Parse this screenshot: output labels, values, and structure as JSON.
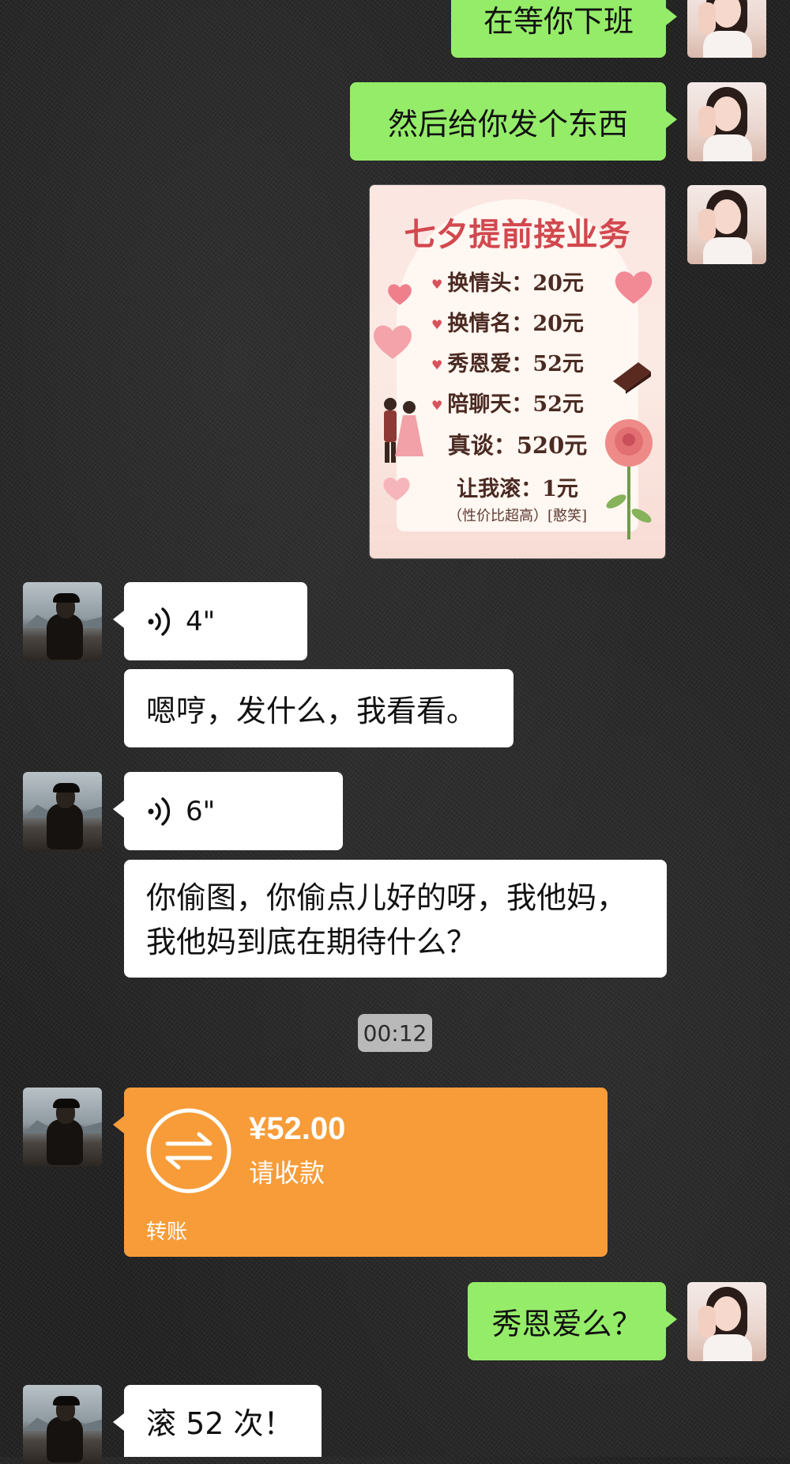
{
  "colors": {
    "sent_bubble": "#95ec69",
    "received_bubble": "#ffffff",
    "transfer_card": "#f79c39",
    "timestamp_bg": "#b9b9b9",
    "chat_background": "#252525"
  },
  "messages": {
    "sent_1": "在等你下班",
    "sent_2": "然后给你发个东西",
    "voice_1_duration": "4\"",
    "reply_1": "嗯哼，发什么，我看看。",
    "voice_2_duration": "6\"",
    "reply_2": "你偷图，你偷点儿好的呀，我他妈，我他妈到底在期待什么？",
    "sent_3": "秀恩爱么？",
    "reply_3": "滚 52 次！"
  },
  "poster": {
    "title": "七夕提前接业务",
    "items": [
      "换情头：20元",
      "换情名：20元",
      "秀恩爱：52元",
      "陪聊天：52元"
    ],
    "highlight": "真谈：520元",
    "last": "让我滚：1元",
    "note": "（性价比超高）[憨笑]"
  },
  "timestamp": "00:12",
  "transfer": {
    "amount": "¥52.00",
    "status": "请收款",
    "label": "转账"
  },
  "icons": {
    "voice": "voice-wave-icon",
    "transfer": "transfer-arrows-icon"
  }
}
